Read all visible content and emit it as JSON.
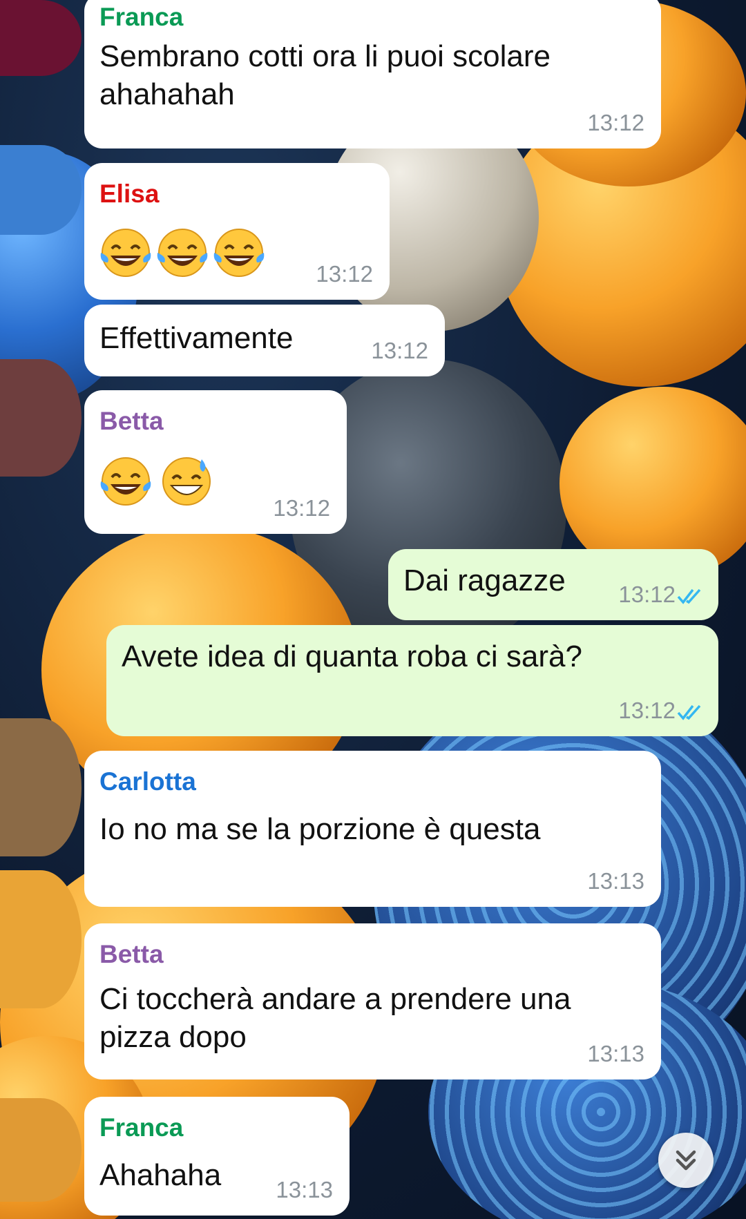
{
  "colors": {
    "incoming_bubble": "#ffffff",
    "outgoing_bubble": "#e5fcd6",
    "timestamp": "#8a9299",
    "read_ticks": "#34b7f1",
    "sender_franca": "#0a9a55",
    "sender_elisa": "#dd1111",
    "sender_betta": "#8a5aa8",
    "sender_carlotta": "#1a73d4"
  },
  "messages": [
    {
      "sender": "Franca",
      "text": "Sembrano cotti ora li puoi scolare\nahahahah",
      "time": "13:12"
    },
    {
      "sender": "Elisa",
      "emojis": [
        "face-with-tears-of-joy",
        "face-with-tears-of-joy",
        "face-with-tears-of-joy"
      ],
      "time": "13:12"
    },
    {
      "text": "Effettivamente",
      "time": "13:12"
    },
    {
      "sender": "Betta",
      "emojis": [
        "face-with-tears-of-joy",
        "grinning-face-with-sweat"
      ],
      "time": "13:12"
    },
    {
      "text": "Dai ragazze",
      "time": "13:12",
      "status": "read"
    },
    {
      "text": "Avete idea di quanta roba ci sarà?",
      "time": "13:12",
      "status": "read"
    },
    {
      "sender": "Carlotta",
      "text": "Io no ma se la porzione è questa",
      "time": "13:13"
    },
    {
      "sender": "Betta",
      "text": "Ci toccherà andare a prendere una\npizza dopo",
      "time": "13:13"
    },
    {
      "sender": "Franca",
      "text": "Ahahaha",
      "time": "13:13"
    }
  ],
  "scroll_down_icon": "double-chevron-down-icon"
}
